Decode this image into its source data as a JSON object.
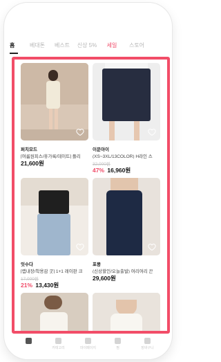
{
  "tabs": [
    {
      "label": "홈",
      "active": true
    },
    {
      "label": "베대톤",
      "active": false
    },
    {
      "label": "베스트",
      "active": false
    },
    {
      "label": "신상 5%",
      "active": false
    },
    {
      "label": "세일",
      "active": false,
      "hot": true
    },
    {
      "label": "스토어",
      "active": false
    }
  ],
  "products": [
    {
      "store": "퍼치모드",
      "name": "[여름원피스/휴가룩/데이트] 플리",
      "original_price": "",
      "discount": "",
      "price": "21,600원"
    },
    {
      "store": "이문아이",
      "name": "(XS~3XL/13COLOR) H라인 스",
      "original_price": "32,000원",
      "discount": "47%",
      "price": "16,960원"
    },
    {
      "store": "잇수다",
      "name": "[캡내장/착용감 굿] 1+1 레이판 크",
      "original_price": "17,000원",
      "discount": "21%",
      "price": "13,430원"
    },
    {
      "store": "포몽",
      "name": "(신상할인/오늘출발) 여리여리 끈",
      "original_price": "",
      "discount": "",
      "price": "29,600원"
    },
    {
      "store": "",
      "name": "",
      "original_price": "",
      "discount": "",
      "price": ""
    },
    {
      "store": "",
      "name": "",
      "original_price": "",
      "discount": "",
      "price": ""
    }
  ],
  "bottom_nav": [
    {
      "label": "",
      "icon": "home-icon",
      "active": true
    },
    {
      "label": "카테고리",
      "icon": "category-icon",
      "active": false
    },
    {
      "label": "마이페이지",
      "icon": "user-icon",
      "active": false
    },
    {
      "label": "찜",
      "icon": "heart-icon",
      "active": false
    },
    {
      "label": "장바구니",
      "icon": "cart-icon",
      "active": false
    }
  ],
  "colors": {
    "accent": "#f04a67",
    "frame": "#f24d68"
  }
}
